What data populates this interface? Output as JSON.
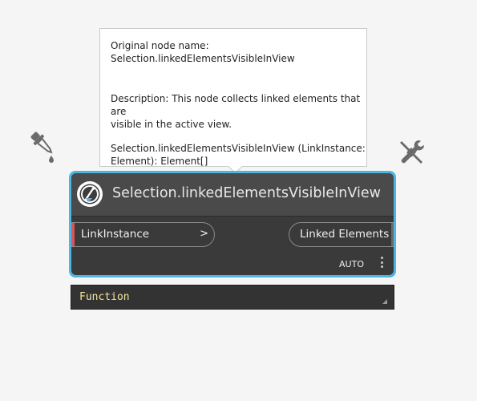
{
  "tooltip": {
    "original_name_label": "Original node name:",
    "original_name_value": "Selection.linkedElementsVisibleInView",
    "description": "Description:  This node collects linked elements that are\nvisible in the active view.",
    "signature": "Selection.linkedElementsVisibleInView (LinkInstance:\nElement): Element[]"
  },
  "node": {
    "title": "Selection.linkedElementsVisibleInView",
    "input_port": {
      "label": "LinkInstance",
      "arrow": ">"
    },
    "output_port": {
      "label": "Linked Elements"
    },
    "lacing": "AUTO",
    "border_color": "#4db5e0"
  },
  "preview": {
    "label": "Function"
  },
  "icons": [
    "eyedropper-icon",
    "tools-icon",
    "node-logo-icon",
    "more-options-icon",
    "expand-preview-icon"
  ]
}
